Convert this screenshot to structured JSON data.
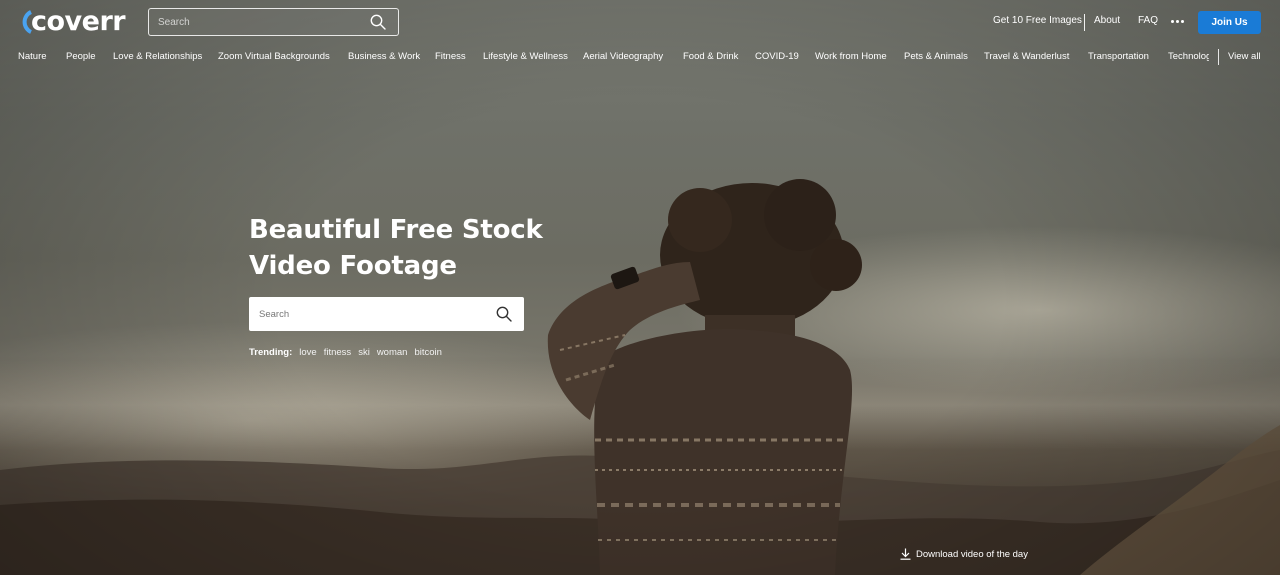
{
  "brand": {
    "logo_text": "coverr",
    "accent_color": "#1a7bd6",
    "logo_mark_color": "#4aa3f0"
  },
  "header": {
    "search_placeholder": "Search",
    "links": {
      "free_images": "Get 10 Free Images",
      "about": "About",
      "faq": "FAQ"
    },
    "more_icon": "more-dots-icon",
    "join_label": "Join Us"
  },
  "categories": {
    "items": [
      "Nature",
      "People",
      "Love & Relationships",
      "Zoom Virtual Backgrounds",
      "Business & Work",
      "Fitness",
      "Lifestyle & Wellness",
      "Aerial Videography",
      "Food & Drink",
      "COVID-19",
      "Work from Home",
      "Pets & Animals",
      "Travel & Wanderlust",
      "Transportation",
      "Technology"
    ],
    "view_all": "View all"
  },
  "hero": {
    "headline_line1": "Beautiful Free Stock",
    "headline_line2": "Video Footage",
    "search_placeholder": "Search",
    "trending_label": "Trending:",
    "trending": [
      "love",
      "fitness",
      "ski",
      "woman",
      "bitcoin"
    ],
    "download_label": "Download video of the day"
  }
}
